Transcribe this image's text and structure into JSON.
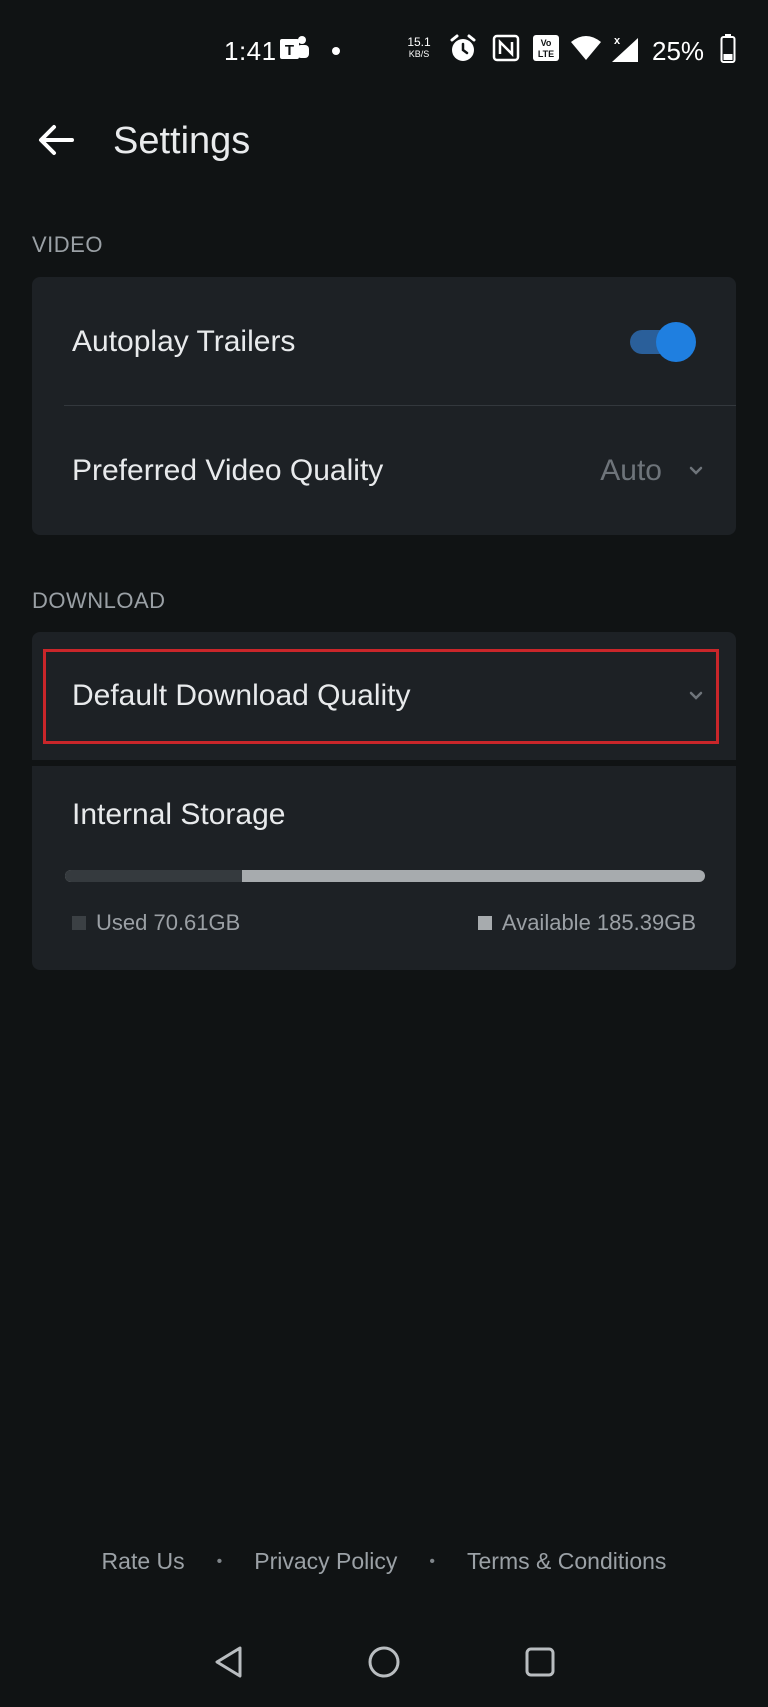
{
  "status_bar": {
    "time": "1:41",
    "speed_value": "15.1",
    "speed_unit": "KB/S",
    "battery": "25%",
    "icons": [
      "teams-icon",
      "alarm-icon",
      "nfc-icon",
      "volte-icon",
      "wifi-icon",
      "signal-icon",
      "battery-icon"
    ]
  },
  "header": {
    "title": "Settings",
    "back_icon": "arrow-left-icon"
  },
  "video": {
    "section_label": "VIDEO",
    "autoplay_label": "Autoplay Trailers",
    "autoplay_enabled": true,
    "quality_label": "Preferred Video Quality",
    "quality_value": "Auto"
  },
  "download": {
    "section_label": "DOWNLOAD",
    "quality_label": "Default Download Quality"
  },
  "storage": {
    "title": "Internal Storage",
    "used_label": "Used 70.61GB",
    "available_label": "Available 185.39GB",
    "used_fraction": 0.276
  },
  "footer": {
    "rate_us": "Rate Us",
    "privacy_policy": "Privacy Policy",
    "terms": "Terms & Conditions",
    "separator": "•"
  },
  "colors": {
    "accent": "#1f7fe0",
    "highlight": "#c9262a",
    "background": "#101314",
    "card": "#1d2125"
  }
}
